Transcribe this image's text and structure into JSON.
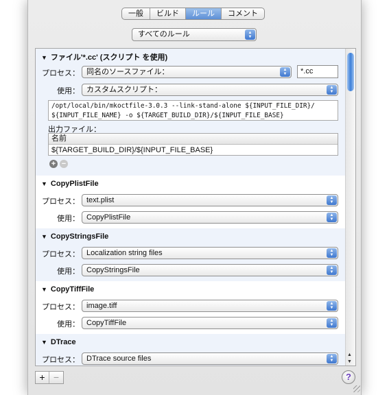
{
  "tabs": [
    "一般",
    "ビルド",
    "ルール",
    "コメント"
  ],
  "active_tab": 2,
  "filter_popup": "すべてのルール",
  "labels": {
    "process": "プロセス：",
    "use": "使用："
  },
  "rules": [
    {
      "title": "ファイル'*.cc' (スクリプト を使用)",
      "process": "同名のソースファイル：",
      "extension": "*.cc",
      "use": "カスタムスクリプト：",
      "script_line1": "/opt/local/bin/mkoctfile-3.0.3 --link-stand-alone ${INPUT_FILE_DIR}/",
      "script_line2": "${INPUT_FILE_NAME} -o ${TARGET_BUILD_DIR}/${INPUT_FILE_BASE}",
      "output_label": "出力ファイル：",
      "output_header": "名前",
      "output_value": "${TARGET_BUILD_DIR}/${INPUT_FILE_BASE}"
    },
    {
      "title": "CopyPlistFile",
      "process": "text.plist",
      "use": "CopyPlistFile"
    },
    {
      "title": "CopyStringsFile",
      "process": "Localization string files",
      "use": "CopyStringsFile"
    },
    {
      "title": "CopyTiffFile",
      "process": "image.tiff",
      "use": "CopyTiffFile"
    },
    {
      "title": "DTrace",
      "process": "DTrace source files"
    }
  ],
  "icons": {
    "disclosure": "disclosure-triangle-icon",
    "add": "plus-icon",
    "remove": "minus-icon",
    "help": "question-mark-icon"
  },
  "bottom": {
    "add": "+",
    "remove": "−",
    "help": "?"
  },
  "colors": {
    "accent": "#3f78cf",
    "alt_row": "#eef3fb"
  }
}
